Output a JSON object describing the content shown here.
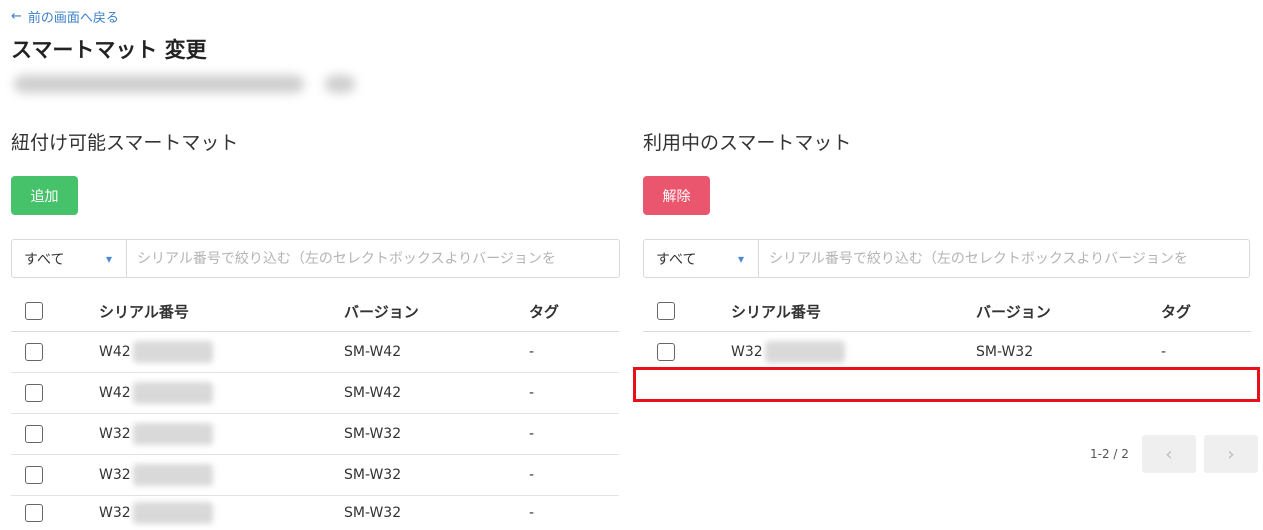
{
  "header": {
    "back_label": "前の画面へ戻る",
    "back_icon": "arrow-left-icon",
    "title": "スマートマット 変更"
  },
  "left_panel": {
    "title": "紐付け可能スマートマット",
    "add_label": "追加",
    "filter": {
      "selected": "すべて",
      "placeholder": "シリアル番号で絞り込む（左のセレクトボックスよりバージョンを"
    },
    "columns": {
      "serial": "シリアル番号",
      "version": "バージョン",
      "tag": "タグ"
    },
    "rows": [
      {
        "serial": "W42",
        "version": "SM-W42",
        "tag": "-"
      },
      {
        "serial": "W42",
        "version": "SM-W42",
        "tag": "-"
      },
      {
        "serial": "W32",
        "version": "SM-W32",
        "tag": "-"
      },
      {
        "serial": "W32",
        "version": "SM-W32",
        "tag": "-"
      },
      {
        "serial": "W32",
        "version": "SM-W32",
        "tag": "-"
      }
    ]
  },
  "right_panel": {
    "title": "利用中のスマートマット",
    "remove_label": "解除",
    "filter": {
      "selected": "すべて",
      "placeholder": "シリアル番号で絞り込む（左のセレクトボックスよりバージョンを"
    },
    "columns": {
      "serial": "シリアル番号",
      "version": "バージョン",
      "tag": "タグ"
    },
    "rows": [
      {
        "serial": "W32",
        "version": "SM-W32",
        "tag": "-"
      }
    ],
    "pagination": {
      "info": "1-2 / 2",
      "prev_icon": "chevron-left-icon",
      "next_icon": "chevron-right-icon"
    }
  },
  "colors": {
    "add_button": "#46c26b",
    "remove_button": "#ea566d",
    "link": "#3d7fc9",
    "highlight": "#e8101a"
  }
}
